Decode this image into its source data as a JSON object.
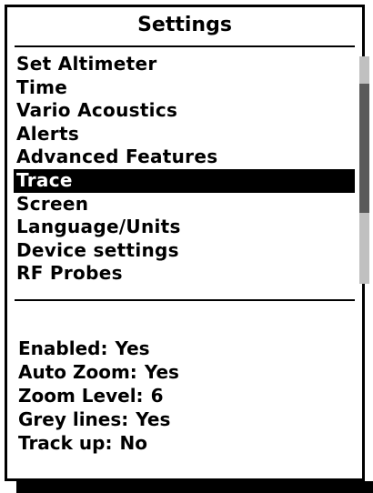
{
  "header": {
    "title": "Settings"
  },
  "menu": {
    "items": [
      {
        "label": "Set Altimeter"
      },
      {
        "label": "Time"
      },
      {
        "label": "Vario Acoustics"
      },
      {
        "label": "Alerts"
      },
      {
        "label": "Advanced Features"
      },
      {
        "label": "Trace"
      },
      {
        "label": "Screen"
      },
      {
        "label": "Language/Units"
      },
      {
        "label": "Device settings"
      },
      {
        "label": "RF Probes"
      }
    ],
    "selected_index": 5
  },
  "details": {
    "rows": [
      {
        "label": "Enabled:",
        "value": "Yes"
      },
      {
        "label": "Auto Zoom:",
        "value": "Yes"
      },
      {
        "label": "Zoom Level:",
        "value": "6"
      },
      {
        "label": "Grey lines:",
        "value": "Yes"
      },
      {
        "label": "Track up:",
        "value": "No"
      }
    ]
  },
  "colors": {
    "background": "#ffffff",
    "foreground": "#000000",
    "selection_background": "#000000",
    "selection_text": "#ffffff",
    "scroll_track": "#c0c0c0",
    "scroll_thumb": "#5a5a5a"
  }
}
